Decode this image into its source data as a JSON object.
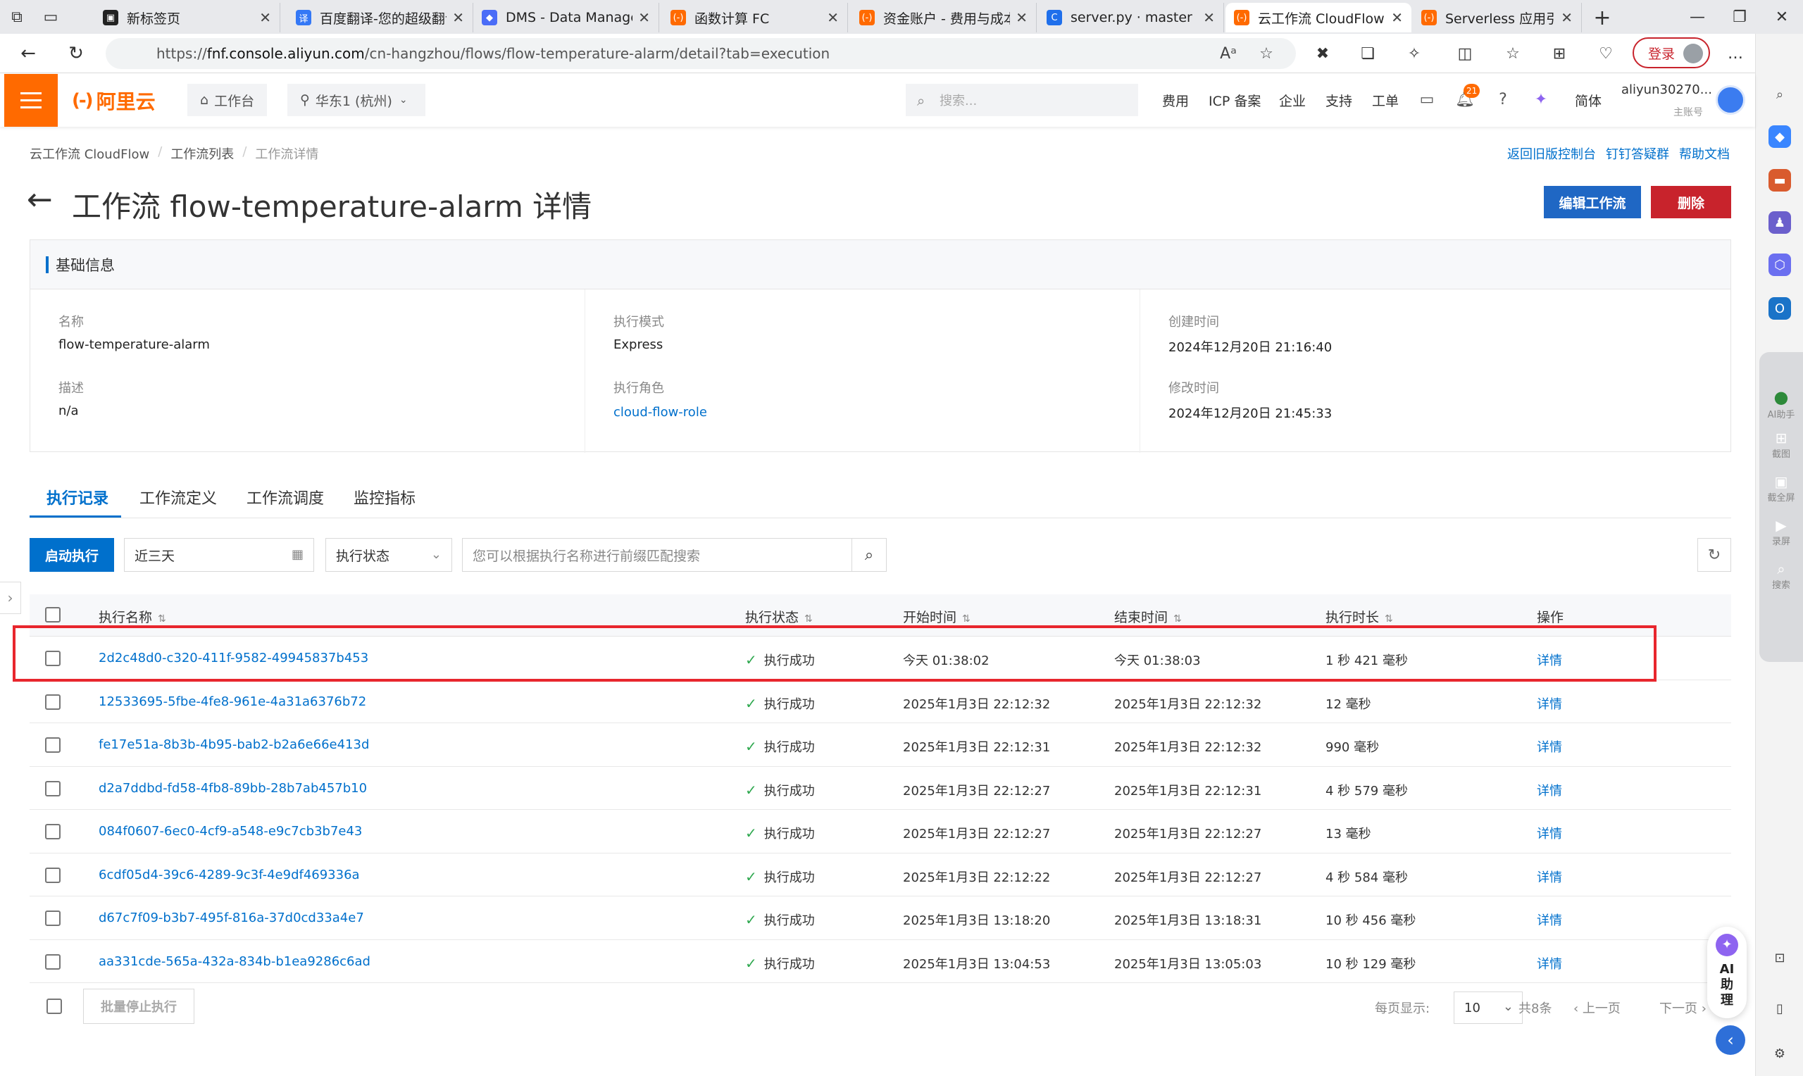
{
  "browser": {
    "tabs": [
      {
        "title": "新标签页",
        "favicon_color": "#222222",
        "glyph": "▣"
      },
      {
        "title": "百度翻译-您的超级翻译",
        "favicon_color": "#3478f6",
        "glyph": "译"
      },
      {
        "title": "DMS - Data Managem",
        "favicon_color": "#4a6cf7",
        "glyph": "◆"
      },
      {
        "title": "函数计算 FC",
        "favicon_color": "#ff6a00",
        "glyph": "(-)"
      },
      {
        "title": "资金账户 - 费用与成本",
        "favicon_color": "#ff6a00",
        "glyph": "(-)"
      },
      {
        "title": "server.py · master · sr",
        "favicon_color": "#1f6feb",
        "glyph": "C"
      },
      {
        "title": "云工作流 CloudFlow",
        "favicon_color": "#ff6a00",
        "glyph": "(-)"
      },
      {
        "title": "Serverless 应用引擎",
        "favicon_color": "#ff6a00",
        "glyph": "(-)"
      }
    ],
    "url_prefix": "https://",
    "url_host": "fnf.console.aliyun.com",
    "url_path": "/cn-hangzhou/flows/flow-temperature-alarm/detail?tab=execution",
    "login_label": "登录"
  },
  "console": {
    "brand": "阿里云",
    "workbench": "工作台",
    "region": "华东1 (杭州)",
    "search_placeholder": "搜索...",
    "links": [
      "费用",
      "ICP 备案",
      "企业",
      "支持",
      "工单"
    ],
    "notification_count": "21",
    "lang": "简体",
    "account_name": "aliyun30270...",
    "account_type": "主账号"
  },
  "breadcrumb": [
    "云工作流 CloudFlow",
    "工作流列表",
    "工作流详情"
  ],
  "top_links": [
    "返回旧版控制台",
    "钉钉答疑群",
    "帮助文档"
  ],
  "page": {
    "title": "工作流 flow-temperature-alarm 详情",
    "edit_button": "编辑工作流",
    "delete_button": "删除"
  },
  "basic_info": {
    "header": "基础信息",
    "name_label": "名称",
    "name_value": "flow-temperature-alarm",
    "desc_label": "描述",
    "desc_value": "n/a",
    "mode_label": "执行模式",
    "mode_value": "Express",
    "role_label": "执行角色",
    "role_value": "cloud-flow-role",
    "created_label": "创建时间",
    "created_value": "2024年12月20日 21:16:40",
    "modified_label": "修改时间",
    "modified_value": "2024年12月20日 21:45:33"
  },
  "tabs": [
    "执行记录",
    "工作流定义",
    "工作流调度",
    "监控指标"
  ],
  "toolbar": {
    "start_button": "启动执行",
    "date_range": "近三天",
    "status_filter": "执行状态",
    "search_placeholder": "您可以根据执行名称进行前缀匹配搜索"
  },
  "table": {
    "columns": [
      "执行名称",
      "执行状态",
      "开始时间",
      "结束时间",
      "执行时长",
      "操作"
    ],
    "rows": [
      {
        "name": "2d2c48d0-c320-411f-9582-49945837b453",
        "status": "执行成功",
        "start": "今天 01:38:02",
        "end": "今天 01:38:03",
        "duration": "1 秒 421 毫秒",
        "action": "详情"
      },
      {
        "name": "12533695-5fbe-4fe8-961e-4a31a6376b72",
        "status": "执行成功",
        "start": "2025年1月3日 22:12:32",
        "end": "2025年1月3日 22:12:32",
        "duration": "12 毫秒",
        "action": "详情"
      },
      {
        "name": "fe17e51a-8b3b-4b95-bab2-b2a6e66e413d",
        "status": "执行成功",
        "start": "2025年1月3日 22:12:31",
        "end": "2025年1月3日 22:12:32",
        "duration": "990 毫秒",
        "action": "详情"
      },
      {
        "name": "d2a7ddbd-fd58-4fb8-89bb-28b7ab457b10",
        "status": "执行成功",
        "start": "2025年1月3日 22:12:27",
        "end": "2025年1月3日 22:12:31",
        "duration": "4 秒 579 毫秒",
        "action": "详情"
      },
      {
        "name": "084f0607-6ec0-4cf9-a548-e9c7cb3b7e43",
        "status": "执行成功",
        "start": "2025年1月3日 22:12:27",
        "end": "2025年1月3日 22:12:27",
        "duration": "13 毫秒",
        "action": "详情"
      },
      {
        "name": "6cdf05d4-39c6-4289-9c3f-4e9df469336a",
        "status": "执行成功",
        "start": "2025年1月3日 22:12:22",
        "end": "2025年1月3日 22:12:27",
        "duration": "4 秒 584 毫秒",
        "action": "详情"
      },
      {
        "name": "d67c7f09-b3b7-495f-816a-37d0cd33a4e7",
        "status": "执行成功",
        "start": "2025年1月3日 13:18:20",
        "end": "2025年1月3日 13:18:31",
        "duration": "10 秒 456 毫秒",
        "action": "详情"
      },
      {
        "name": "aa331cde-565a-432a-834b-b1ea9286c6ad",
        "status": "执行成功",
        "start": "2025年1月3日 13:04:53",
        "end": "2025年1月3日 13:05:03",
        "duration": "10 秒 129 毫秒",
        "action": "详情"
      }
    ]
  },
  "footer": {
    "batch_stop": "批量停止执行",
    "per_page_label": "每页显示:",
    "per_page_value": "10",
    "total": "共8条",
    "prev": "上一页",
    "next": "下一页"
  },
  "ai_assistant": {
    "label": "AI 助 理",
    "dock_labels": [
      "AI助手",
      "截图",
      "截全屏",
      "录屏",
      "搜索"
    ]
  },
  "colors": {
    "brand_orange": "#ff6a00",
    "primary_blue": "#0070cc",
    "danger_red": "#c8232c",
    "highlight_red": "#e8262d",
    "success_green": "#2fa84f"
  }
}
